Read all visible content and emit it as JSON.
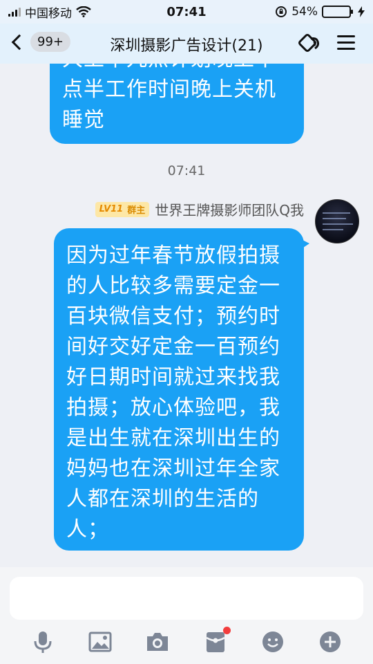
{
  "status_bar": {
    "carrier": "中国移动",
    "time": "07:41",
    "battery_percent": "54%",
    "battery_level": 0.54,
    "icons": [
      "signal-icon",
      "wifi-icon",
      "orientation-lock-icon",
      "battery-icon",
      "charging-icon"
    ]
  },
  "nav": {
    "back_badge": "99+",
    "title": "深圳摄影广告设计(21)",
    "icons": [
      "chevron-left-icon",
      "voice-call-icon",
      "menu-icon"
    ]
  },
  "chat": {
    "previous_message_lines": [
      "大上午九点计划晚上十",
      "点半工作时间晚上关机",
      "睡觉"
    ],
    "timestamp": "07:41",
    "sender": {
      "level": "LV11",
      "role": "群主",
      "name": "世界王牌摄影师团队Q我"
    },
    "message_lines": [
      "因为过年春节放假拍摄",
      "的人比较多需要定金一",
      "百块微信支付；预约时",
      "间好交好定金一百预约",
      "好日期时间就过来找我",
      "拍摄；放心体验吧，我",
      "是出生就在深圳出生的",
      "妈妈也在深圳过年全家",
      "人都在深圳的生活的",
      "人；"
    ],
    "bubble_color": "#1aa1f5"
  },
  "input": {
    "placeholder": "",
    "toolbar": [
      "microphone-icon",
      "image-icon",
      "camera-icon",
      "red-packet-icon",
      "emoji-icon",
      "plus-icon"
    ],
    "notification_dot_color": "#f23d3d"
  }
}
